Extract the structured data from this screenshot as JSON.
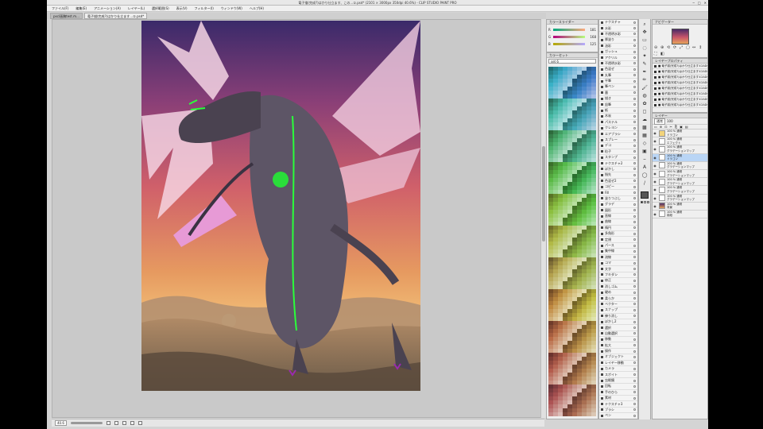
{
  "window": {
    "title": "竜子描(完成?)はかり仕立ます、この…①.psd* (2101 × 3000px 350dpi 40.6%) - CLIP STUDIO PAINT PRO",
    "controls": [
      "─",
      "□",
      "✕"
    ]
  },
  "menu": {
    "items": [
      "ファイル(F)",
      "編集(E)",
      "アニメーション(A)",
      "レイヤー(L)",
      "選択範囲(S)",
      "表示(V)",
      "フィルター(I)",
      "ウィンドウ(W)",
      "ヘルプ(H)"
    ]
  },
  "tabs": [
    {
      "label": "pxcl画稿test.m…",
      "active": false
    },
    {
      "label": "竜子描(完成?)はかり仕立ます…①.psd*",
      "active": true
    }
  ],
  "status": {
    "zoom": "40.6"
  },
  "color_slider": {
    "title": "カラースライダー",
    "rows": [
      {
        "label": "R",
        "value": "181"
      },
      {
        "label": "G",
        "value": "168"
      },
      {
        "label": "B",
        "value": "125"
      }
    ]
  },
  "color_set": {
    "title": "カラーセット",
    "selected": "set 6"
  },
  "sub_tools": {
    "rows": [
      "テクスチャ",
      "水彩",
      "不透明水彩",
      "厚塗り",
      "油彩",
      "ガッシュ",
      "アクリル",
      "不透明水彩",
      "色混ぜ",
      "丸筆",
      "平筆",
      "筆ペン",
      "墨",
      "描き",
      "鉛筆",
      "紙",
      "木炭",
      "パステル",
      "クレヨン",
      "エアブラシ",
      "スプレー",
      "デコ",
      "粒子",
      "スタンプ",
      "テクスチャ2",
      "ぼかし",
      "指先",
      "色混ぜ2",
      "コピー",
      "Fill",
      "塗りつぶし",
      "グラデ",
      "図形",
      "直線",
      "曲線",
      "楕円",
      "多角形",
      "定規",
      "パース",
      "集中線",
      "流線",
      "コマ",
      "文字",
      "フキダシ",
      "修正",
      "消しゴム",
      "硬め",
      "柔らか",
      "ベクター",
      "スナップ",
      "練り消し",
      "ぼかし2",
      "選択",
      "自動選択",
      "移動",
      "拡大",
      "操作",
      "オブジェクト",
      "レイヤー移動",
      "カメラ",
      "スポイト",
      "虫眼鏡",
      "回転",
      "手のひら",
      "素材",
      "テクスチャ3",
      "ブラシ",
      "ペン"
    ]
  },
  "tools": {
    "icons": [
      "magnifier-icon",
      "move-icon",
      "select-icon",
      "lasso-icon",
      "wand-icon",
      "eyedropper-icon",
      "pen-icon",
      "pencil-icon",
      "brush-icon",
      "airbrush-icon",
      "decoration-icon",
      "eraser-icon",
      "blend-icon",
      "fill-icon",
      "gradient-icon",
      "figure-icon",
      "frame-icon",
      "ruler-icon",
      "text-icon",
      "balloon-icon",
      "line-icon"
    ],
    "glyphs": [
      "⌕",
      "✥",
      "▭",
      "◌",
      "✦",
      "✎",
      "✒",
      "✏",
      "🖌",
      "◍",
      "✿",
      "◻",
      "☁",
      "▩",
      "▦",
      "◇",
      "▣",
      "⎯",
      "A",
      "◯",
      "/"
    ]
  },
  "navigator": {
    "title": "ナビゲーター",
    "tools": [
      "⊖",
      "⊕",
      "⟲",
      "⟳",
      "⤢",
      "▢",
      "↔",
      "↕",
      "⛶",
      "◧"
    ]
  },
  "sub_layers": {
    "title": "レイヤープロパティ",
    "rows": [
      "■ 竜子描(完成?)はかり仕立ます①2ADO",
      "■ 竜子描(完成?)はかり仕立ます①2ADO",
      "■ 竜子描(完成?)はかり仕立ます①2ADO",
      "■ 竜子描(完成?)はかり仕立ます①2ADO",
      "■ 竜子描(完成?)はかり仕立ます①2ADO",
      "■ 竜子描(完成?)はかり仕立ます①2ADO",
      "■ 竜子描(完成?)はかり仕立ます①2ADO",
      "■ 竜子描(完成?)はかり仕立ます①2ADO"
    ]
  },
  "layers": {
    "title": "レイヤー",
    "blend": "通常",
    "opacity": "100",
    "icons": [
      "▭",
      "⊕",
      "⊡",
      "✂",
      "⎘",
      "▣",
      "▤"
    ],
    "rows": [
      {
        "line1": "100 % 通常",
        "line2": "ドラゴン",
        "folder": true,
        "selected": false
      },
      {
        "line1": "100 % 通常",
        "line2": "エフェクト",
        "folder": false,
        "selected": false
      },
      {
        "line1": "100 % 通常",
        "line2": "グラデーションマップ",
        "folder": false,
        "selected": false
      },
      {
        "line1": "100 % 通常",
        "line2": "ドラゴン",
        "folder": false,
        "selected": true
      },
      {
        "line1": "100 % 通常",
        "line2": "グラデーションマップ",
        "folder": false,
        "selected": false
      },
      {
        "line1": "100 % 通常",
        "line2": "グラデーションマップ",
        "folder": false,
        "selected": false
      },
      {
        "line1": "100 % 通常",
        "line2": "グラデーションマップ",
        "folder": false,
        "selected": false
      },
      {
        "line1": "100 % 通常",
        "line2": "グラデーションマップ",
        "folder": false,
        "selected": false
      },
      {
        "line1": "100 % 通常",
        "line2": "グラデーションマップ",
        "folder": false,
        "selected": false
      },
      {
        "line1": "100 % 通常",
        "line2": "背景",
        "folder": false,
        "selected": false
      },
      {
        "line1": "100 % 通常",
        "line2": "用紙",
        "folder": false,
        "selected": false
      }
    ]
  },
  "accent": {
    "selection": "#b9d5f5",
    "panel": "#efefef"
  }
}
